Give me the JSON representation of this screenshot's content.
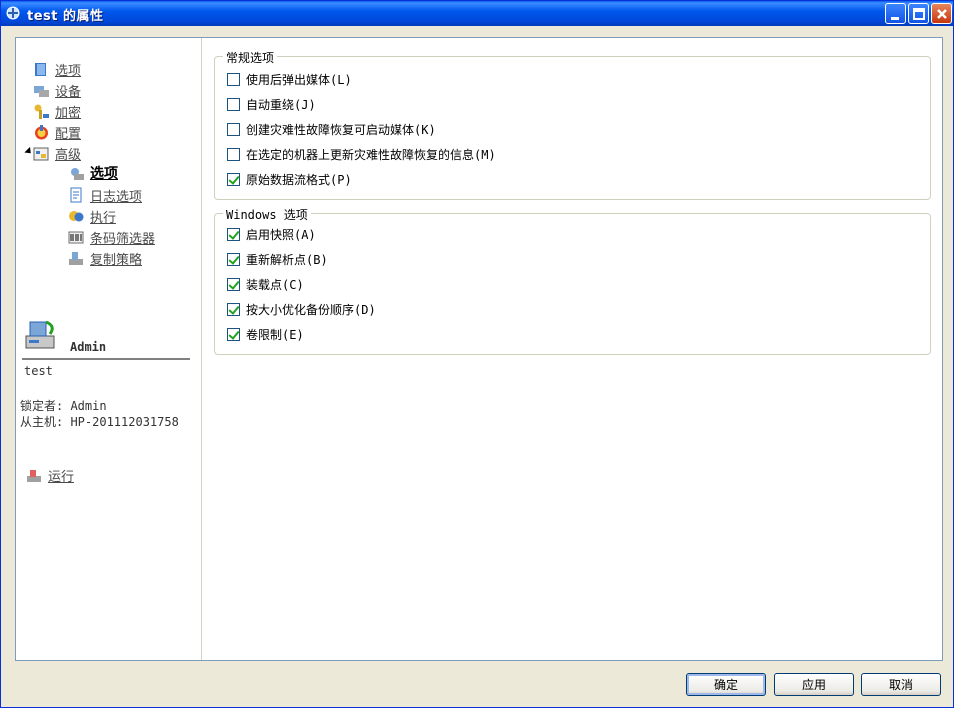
{
  "window": {
    "title": "test 的属性"
  },
  "sidebar": {
    "items": [
      {
        "label": "选项",
        "icon": "book-icon"
      },
      {
        "label": "设备",
        "icon": "devices-icon"
      },
      {
        "label": "加密",
        "icon": "key-icon"
      },
      {
        "label": "配置",
        "icon": "config-icon"
      },
      {
        "label": "高级",
        "icon": "advanced-icon"
      }
    ],
    "subitems": [
      {
        "label": "选项",
        "icon": "options-gear-icon",
        "active": true
      },
      {
        "label": "日志选项",
        "icon": "log-icon"
      },
      {
        "label": "执行",
        "icon": "execute-icon"
      },
      {
        "label": "条码筛选器",
        "icon": "barcode-icon"
      },
      {
        "label": "复制策略",
        "icon": "copy-policy-icon"
      }
    ],
    "user": "Admin",
    "job_name": "test",
    "locked_by": "锁定者: Admin",
    "from_host": "从主机: HP-201112031758",
    "run_label": "运行"
  },
  "general": {
    "title": "常规选项",
    "options": [
      {
        "label": "使用后弹出媒体(L)",
        "checked": false
      },
      {
        "label": "自动重绕(J)",
        "checked": false
      },
      {
        "label": "创建灾难性故障恢复可启动媒体(K)",
        "checked": false
      },
      {
        "label": "在选定的机器上更新灾难性故障恢复的信息(M)",
        "checked": false
      },
      {
        "label": "原始数据流格式(P)",
        "checked": true
      }
    ]
  },
  "windows": {
    "title": "Windows 选项",
    "options": [
      {
        "label": "启用快照(A)",
        "checked": true
      },
      {
        "label": "重新解析点(B)",
        "checked": true
      },
      {
        "label": "装载点(C)",
        "checked": true
      },
      {
        "label": "按大小优化备份顺序(D)",
        "checked": true
      },
      {
        "label": "卷限制(E)",
        "checked": true
      }
    ]
  },
  "buttons": {
    "ok": "确定",
    "apply": "应用",
    "cancel": "取消"
  }
}
